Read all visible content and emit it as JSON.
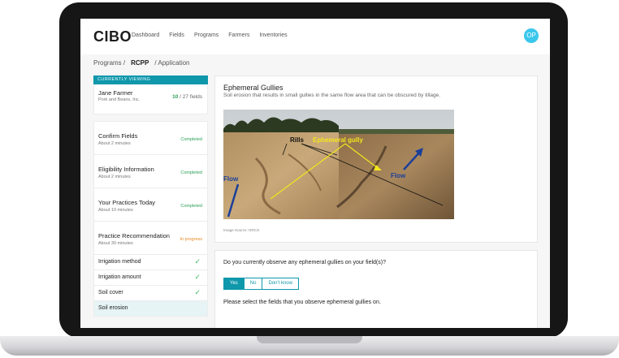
{
  "app": {
    "logo": "CIBO",
    "avatar_initials": "OP"
  },
  "nav": [
    "Dashboard",
    "Fields",
    "Programs",
    "Farmers",
    "Inventories"
  ],
  "breadcrumb": {
    "programs": "Programs /",
    "rcpp": "RCPP",
    "application": "/ Application"
  },
  "sidebar": {
    "currently_viewing": "CURRENTLY VIEWING",
    "farmer": {
      "name": "Jane Farmer",
      "company": "Pork and Beans, Inc.",
      "fields_count": "10",
      "fields_total": "/ 27 fields"
    },
    "steps": [
      {
        "title": "Confirm Fields",
        "duration": "About 2 minutes",
        "status": "Completed"
      },
      {
        "title": "Eligibility Information",
        "duration": "About 2 minutes",
        "status": "Completed"
      },
      {
        "title": "Your Practices Today",
        "duration": "About 10 minutes",
        "status": "Completed"
      },
      {
        "title": "Practice Recommendation",
        "duration": "About 30 minutes",
        "status": "In progress"
      }
    ],
    "substeps": [
      {
        "label": "Irrigation method"
      },
      {
        "label": "Irrigation amount"
      },
      {
        "label": "Soil cover"
      },
      {
        "label": "Soil erosion"
      }
    ]
  },
  "info": {
    "title": "Ephemeral Gullies",
    "description": "Soil erosion that results in small gullies in the same flow area that can be obscured by tillage.",
    "image_source": "Image Source: NRCS",
    "photo_labels": {
      "rills": "Rills",
      "gully": "Ephemeral gully",
      "flow_left": "Flow",
      "flow_right": "Flow"
    },
    "colors": {
      "gully_label": "#f3e61d",
      "flow_arrow": "#1b3f9a"
    }
  },
  "question": {
    "text": "Do you currently observe any ephemeral gullies on your field(s)?",
    "options": [
      "Yes",
      "No",
      "Don't know"
    ],
    "selected": "Yes",
    "followup": "Please select the fields that you observe ephemeral gullies on."
  },
  "colors": {
    "accent": "#0f97ab",
    "completed": "#2da05a",
    "in_progress": "#ea8b24",
    "avatar": "#3bc7ec"
  }
}
